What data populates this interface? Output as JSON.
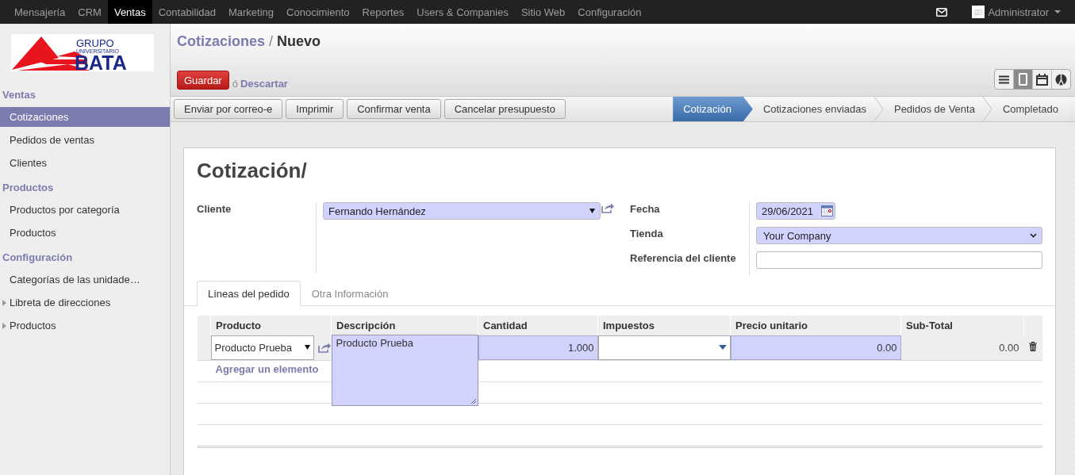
{
  "top_menu": [
    {
      "label": "Mensajería",
      "selected": false
    },
    {
      "label": "CRM",
      "selected": false
    },
    {
      "label": "Ventas",
      "selected": true
    },
    {
      "label": "Contabilidad",
      "selected": false
    },
    {
      "label": "Marketing",
      "selected": false
    },
    {
      "label": "Conocimiento",
      "selected": false
    },
    {
      "label": "Reportes",
      "selected": false
    },
    {
      "label": "Users & Companies",
      "selected": false
    },
    {
      "label": "Sitio Web",
      "selected": false
    },
    {
      "label": "Configuración",
      "selected": false
    }
  ],
  "user": {
    "name": "Administrator"
  },
  "logo": {
    "lines": [
      "GRUPO",
      "UNIVERSITARIO",
      "BATA"
    ]
  },
  "sidebar": [
    {
      "title": "Ventas",
      "items": [
        {
          "label": "Cotizaciones",
          "selected": true,
          "kind": "link"
        },
        {
          "label": "Pedidos de ventas",
          "selected": false,
          "kind": "link"
        },
        {
          "label": "Clientes",
          "selected": false,
          "kind": "link"
        }
      ]
    },
    {
      "title": "Productos",
      "items": [
        {
          "label": "Productos por categoría",
          "selected": false,
          "kind": "link"
        },
        {
          "label": "Productos",
          "selected": false,
          "kind": "link"
        }
      ]
    },
    {
      "title": "Configuración",
      "items": [
        {
          "label": "Categorías de las unidade…",
          "selected": false,
          "kind": "link"
        },
        {
          "label": "Libreta de direcciones",
          "selected": false,
          "kind": "folder"
        },
        {
          "label": "Productos",
          "selected": false,
          "kind": "folder"
        }
      ]
    }
  ],
  "breadcrumb": {
    "parent": "Cotizaciones",
    "separator": "/",
    "current": "Nuevo"
  },
  "edit_actions": {
    "save": "Guardar",
    "or": "ó",
    "discard": "Descartar"
  },
  "views": [
    {
      "kind": "list",
      "selected": false
    },
    {
      "kind": "form",
      "selected": true
    },
    {
      "kind": "calendar",
      "selected": false
    },
    {
      "kind": "graph",
      "selected": false
    }
  ],
  "action_buttons": [
    "Enviar por correo-e",
    "Imprimir",
    "Confirmar venta",
    "Cancelar presupuesto"
  ],
  "stages": [
    {
      "label": "Cotización",
      "selected": true
    },
    {
      "label": "Cotizaciones enviadas",
      "selected": false
    },
    {
      "label": "Pedidos de Venta",
      "selected": false
    },
    {
      "label": "Completado",
      "selected": false
    }
  ],
  "form": {
    "title": "Cotización/",
    "fields_left": [
      {
        "label": "Cliente",
        "kind": "many2one",
        "required": true,
        "value": "Fernando Hernández"
      }
    ],
    "fields_right": [
      {
        "label": "Fecha",
        "kind": "date",
        "required": true,
        "value": "29/06/2021"
      },
      {
        "label": "Tienda",
        "kind": "select",
        "required": true,
        "value": "Your Company"
      },
      {
        "label": "Referencia del cliente",
        "kind": "text",
        "required": false
      }
    ]
  },
  "tabs": [
    {
      "label": "Líneas del pedido",
      "selected": true
    },
    {
      "label": "Otra Información",
      "selected": false
    }
  ],
  "order_lines": {
    "columns": [
      "Producto",
      "Descripción",
      "Cantidad",
      "Impuestos",
      "Precio unitario",
      "Sub-Total"
    ],
    "rows": [
      {
        "product": "Producto Prueba",
        "description": "Producto Prueba",
        "quantity": "1.000",
        "unit_price": "0.00",
        "subtotal": "0.00"
      }
    ],
    "add_link": "Agregar un elemento"
  }
}
